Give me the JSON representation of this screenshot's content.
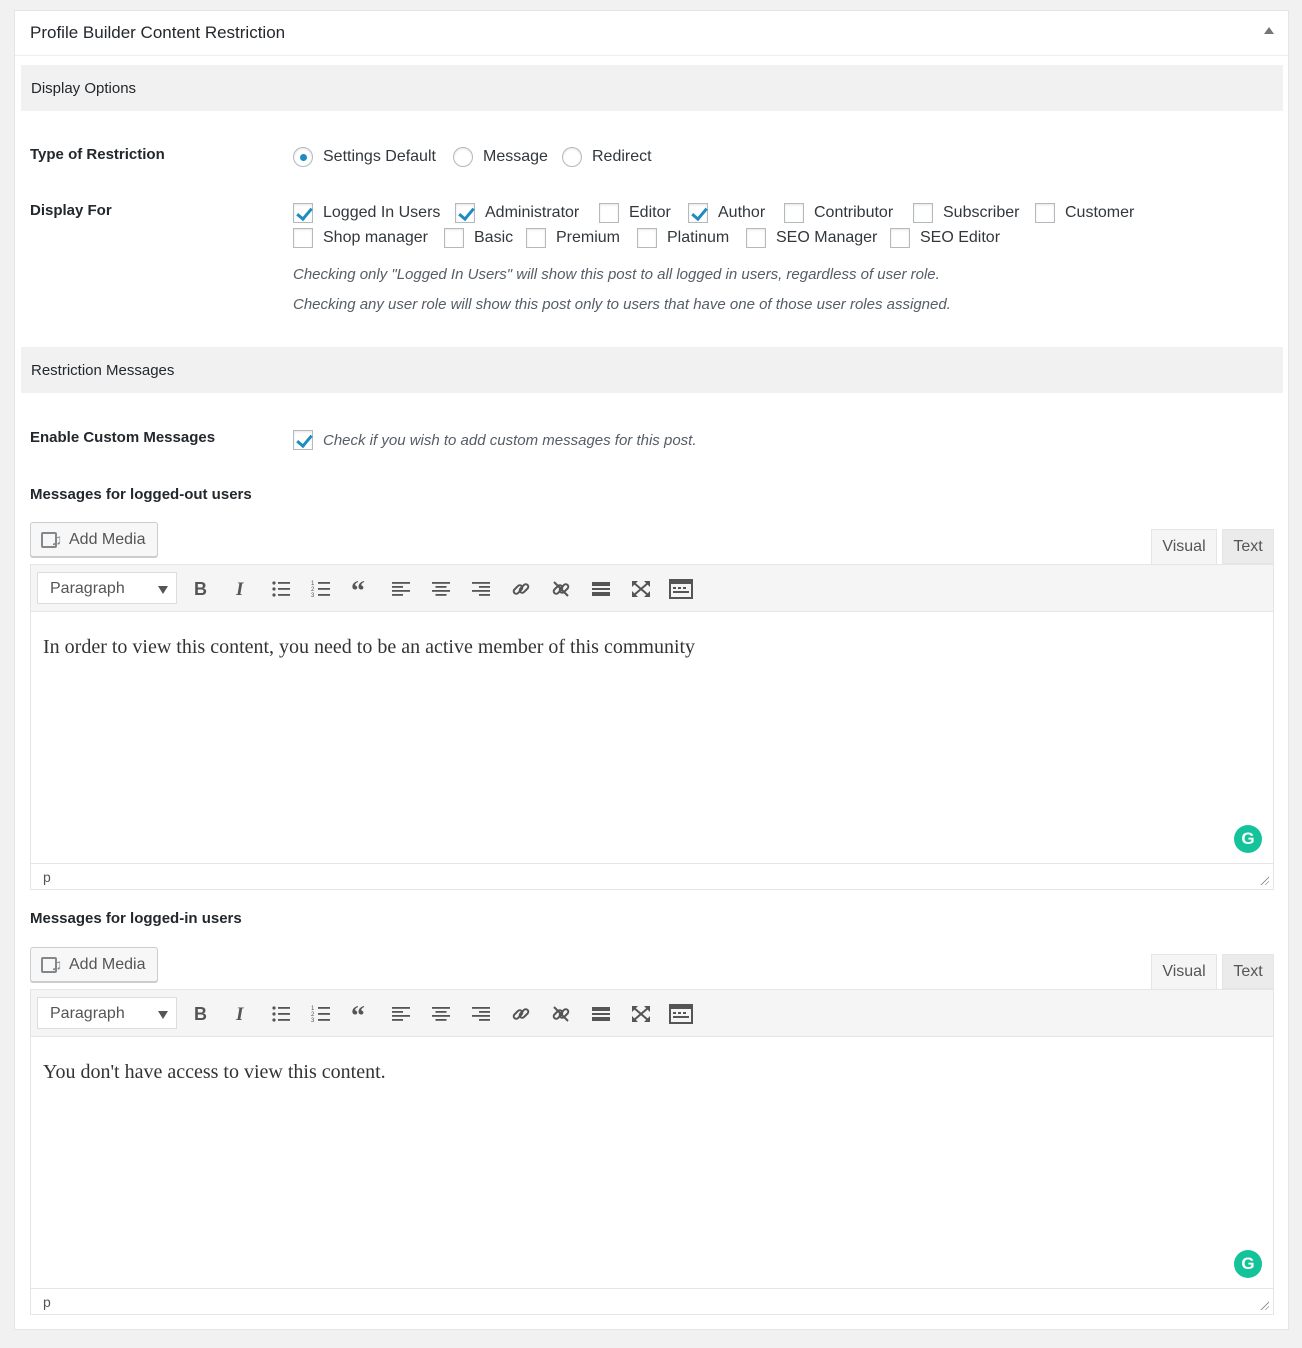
{
  "metabox": {
    "title": "Profile Builder Content Restriction"
  },
  "display_options": {
    "heading": "Display Options",
    "type_label": "Type of Restriction",
    "restriction_types": [
      {
        "label": "Settings Default",
        "selected": true
      },
      {
        "label": "Message",
        "selected": false
      },
      {
        "label": "Redirect",
        "selected": false
      }
    ],
    "display_for_label": "Display For",
    "roles_row1": [
      {
        "label": "Logged In Users",
        "checked": true
      },
      {
        "label": "Administrator",
        "checked": true
      },
      {
        "label": "Editor",
        "checked": false
      },
      {
        "label": "Author",
        "checked": true
      },
      {
        "label": "Contributor",
        "checked": false
      },
      {
        "label": "Subscriber",
        "checked": false
      },
      {
        "label": "Customer",
        "checked": false
      }
    ],
    "roles_row2": [
      {
        "label": "Shop manager",
        "checked": false
      },
      {
        "label": "Basic",
        "checked": false
      },
      {
        "label": "Premium",
        "checked": false
      },
      {
        "label": "Platinum",
        "checked": false
      },
      {
        "label": "SEO Manager",
        "checked": false
      },
      {
        "label": "SEO Editor",
        "checked": false
      }
    ],
    "help1": "Checking only \"Logged In Users\" will show this post to all logged in users, regardless of user role.",
    "help2": "Checking any user role will show this post only to users that have one of those user roles assigned."
  },
  "restriction_messages": {
    "heading": "Restriction Messages",
    "enable_label": "Enable Custom Messages",
    "enable_checked": true,
    "enable_desc": "Check if you wish to add custom messages for this post.",
    "editors": [
      {
        "label": "Messages for logged-out users",
        "content": "In order to view this content, you need to be an active member of this community",
        "path": "p"
      },
      {
        "label": "Messages for logged-in users",
        "content": "You don't have access to view this content.",
        "path": "p"
      }
    ]
  },
  "editor_ui": {
    "add_media": "Add Media",
    "tab_visual": "Visual",
    "tab_text": "Text",
    "format": "Paragraph",
    "toolbar_buttons": [
      "bold-icon",
      "italic-icon",
      "bullet-list-icon",
      "numbered-list-icon",
      "blockquote-icon",
      "align-left-icon",
      "align-center-icon",
      "align-right-icon",
      "link-icon",
      "unlink-icon",
      "read-more-icon",
      "fullscreen-icon",
      "toolbar-toggle-icon"
    ],
    "grammarly_glyph": "G"
  },
  "colors": {
    "accent": "#1e8cbe",
    "grammarly": "#15c39a"
  }
}
